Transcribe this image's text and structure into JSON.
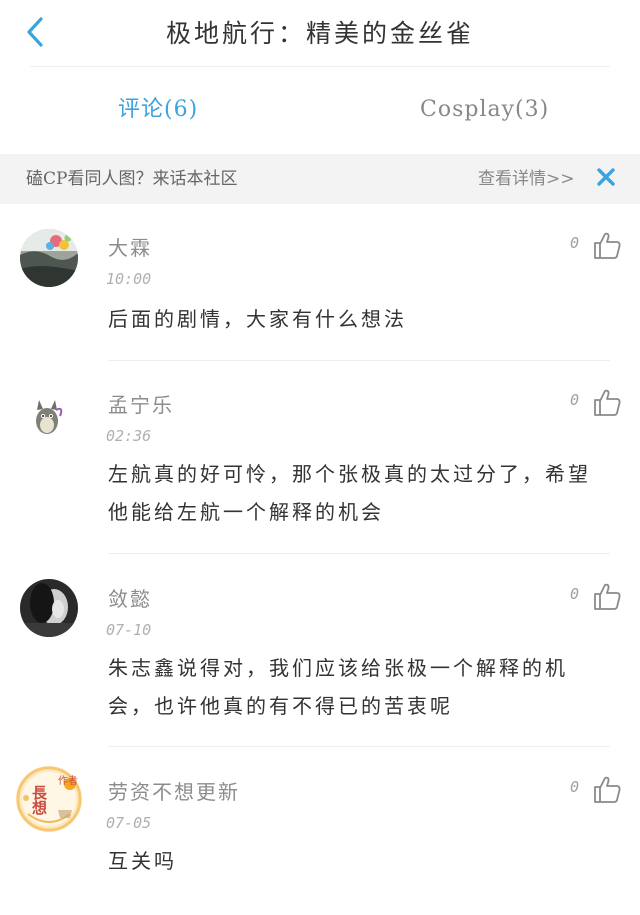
{
  "header": {
    "title": "极地航行：精美的金丝雀"
  },
  "tabs": [
    {
      "label": "评论(6)",
      "active": true
    },
    {
      "label": "Cosplay(3)",
      "active": false
    }
  ],
  "banner": {
    "text": "磕CP看同人图？来话本社区",
    "link": "查看详情>>"
  },
  "comments": [
    {
      "author": "大霖",
      "time": "10:00",
      "likes": "0",
      "text": "后面的剧情，大家有什么想法"
    },
    {
      "author": "孟宁乐",
      "time": "02:36",
      "likes": "0",
      "text": "左航真的好可怜，那个张极真的太过分了，希望他能给左航一个解释的机会"
    },
    {
      "author": "敛懿",
      "time": "07-10",
      "likes": "0",
      "text": "朱志鑫说得对，我们应该给张极一个解释的机会，也许他真的有不得已的苦衷呢"
    },
    {
      "author": "劳资不想更新",
      "time": "07-05",
      "likes": "0",
      "text": "互关吗"
    }
  ],
  "avatar_badge": {
    "top": "作者",
    "main": "長想"
  },
  "colors": {
    "accent": "#3ba3dd",
    "banner_bg": "#f3f3f3",
    "close": "#3ba3dd"
  }
}
